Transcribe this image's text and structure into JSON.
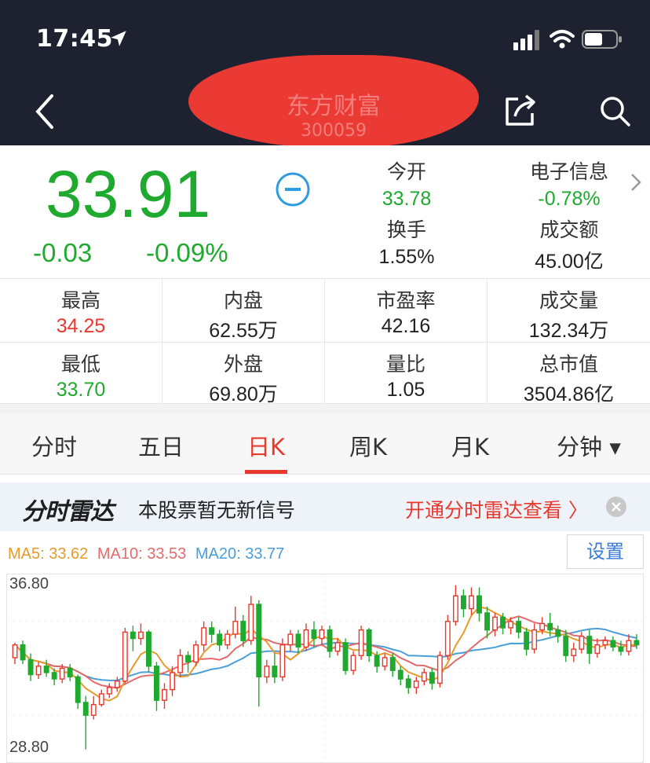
{
  "status_bar": {
    "time": "17:45"
  },
  "header": {
    "stock_name": "东方财富",
    "stock_code": "300059",
    "colors": {
      "background": "#1e2230",
      "redaction": "#ea3a33"
    }
  },
  "quote": {
    "price": "33.91",
    "change": "-0.03",
    "change_pct": "-0.09%",
    "open_label": "今开",
    "open_value": "33.78",
    "sector_label": "电子信息",
    "sector_change": "-0.78%",
    "turnover_label": "换手",
    "turnover_value": "1.55%",
    "amount_label": "成交额",
    "amount_value": "45.00亿",
    "colors": {
      "down": "#1faa2f",
      "up": "#e8392e"
    }
  },
  "stats": [
    {
      "label": "最高",
      "value": "34.25",
      "color": "#e8392e"
    },
    {
      "label": "内盘",
      "value": "62.55万",
      "color": "#222222"
    },
    {
      "label": "市盈率",
      "value": "42.16",
      "color": "#222222"
    },
    {
      "label": "成交量",
      "value": "132.34万",
      "color": "#222222"
    },
    {
      "label": "最低",
      "value": "33.70",
      "color": "#1faa2f"
    },
    {
      "label": "外盘",
      "value": "69.80万",
      "color": "#222222"
    },
    {
      "label": "量比",
      "value": "1.05",
      "color": "#222222"
    },
    {
      "label": "总市值",
      "value": "3504.86亿",
      "color": "#222222"
    }
  ],
  "tabs": [
    {
      "label": "分时"
    },
    {
      "label": "五日"
    },
    {
      "label": "日K",
      "active": true
    },
    {
      "label": "周K"
    },
    {
      "label": "月K"
    },
    {
      "label": "分钟 ▾"
    }
  ],
  "radar": {
    "logo": "分时雷达",
    "message": "本股票暂无新信号",
    "link": "开通分时雷达查看 〉"
  },
  "ma": {
    "ma5": "MA5: 33.62",
    "ma10": "MA10: 33.53",
    "ma20": "MA20: 33.77"
  },
  "settings_label": "设置",
  "chart_data": {
    "type": "candlestick",
    "y_axis_top": "36.80",
    "y_axis_bottom": "28.80",
    "ylim": [
      28.8,
      36.8
    ],
    "ma_colors": {
      "ma5": "#e89b2d",
      "ma10": "#e36b6b",
      "ma20": "#4a9fd8"
    },
    "candles": [
      [
        33.3,
        33.9,
        33.0,
        34.0
      ],
      [
        33.9,
        33.2,
        33.0,
        34.1
      ],
      [
        33.2,
        32.5,
        32.2,
        33.5
      ],
      [
        32.5,
        32.9,
        32.3,
        33.1
      ],
      [
        32.9,
        32.6,
        32.4,
        33.2
      ],
      [
        32.6,
        32.3,
        32.0,
        32.8
      ],
      [
        32.3,
        32.8,
        32.1,
        33.0
      ],
      [
        32.8,
        32.4,
        32.2,
        33.0
      ],
      [
        32.4,
        31.2,
        30.9,
        32.5
      ],
      [
        31.2,
        30.6,
        29.0,
        31.5
      ],
      [
        30.6,
        31.1,
        30.4,
        31.5
      ],
      [
        31.1,
        31.6,
        31.0,
        31.8
      ],
      [
        31.6,
        31.9,
        31.4,
        32.1
      ],
      [
        31.9,
        32.2,
        31.7,
        32.4
      ],
      [
        32.2,
        34.5,
        32.1,
        34.7
      ],
      [
        34.5,
        34.2,
        33.6,
        34.8
      ],
      [
        34.2,
        34.5,
        33.9,
        34.9
      ],
      [
        34.5,
        32.9,
        32.6,
        34.6
      ],
      [
        32.9,
        31.3,
        30.8,
        33.1
      ],
      [
        31.3,
        31.8,
        30.9,
        32.1
      ],
      [
        31.8,
        32.6,
        31.5,
        32.9
      ],
      [
        32.6,
        33.4,
        32.4,
        33.7
      ],
      [
        33.4,
        33.1,
        32.6,
        33.6
      ],
      [
        33.1,
        33.9,
        32.9,
        34.1
      ],
      [
        33.9,
        34.7,
        33.6,
        35.0
      ],
      [
        34.7,
        34.4,
        34.0,
        35.0
      ],
      [
        34.4,
        33.9,
        33.6,
        34.6
      ],
      [
        33.9,
        34.4,
        33.7,
        34.6
      ],
      [
        34.4,
        35.0,
        34.2,
        35.7
      ],
      [
        35.0,
        34.1,
        33.8,
        35.3
      ],
      [
        34.1,
        35.8,
        33.9,
        36.2
      ],
      [
        35.8,
        32.4,
        31.0,
        36.0
      ],
      [
        32.4,
        32.9,
        32.1,
        33.2
      ],
      [
        32.9,
        32.4,
        32.1,
        33.5
      ],
      [
        32.4,
        33.9,
        32.2,
        34.2
      ],
      [
        33.9,
        34.4,
        33.6,
        34.6
      ],
      [
        34.4,
        33.8,
        33.5,
        34.6
      ],
      [
        33.8,
        34.6,
        33.6,
        34.9
      ],
      [
        34.6,
        34.2,
        33.8,
        35.0
      ],
      [
        34.2,
        34.6,
        33.9,
        34.8
      ],
      [
        34.6,
        33.6,
        33.3,
        34.8
      ],
      [
        33.6,
        34.0,
        33.4,
        34.2
      ],
      [
        34.0,
        32.7,
        32.5,
        34.2
      ],
      [
        32.7,
        33.4,
        32.5,
        33.6
      ],
      [
        33.4,
        34.6,
        33.2,
        34.8
      ],
      [
        34.6,
        33.4,
        33.1,
        34.7
      ],
      [
        33.4,
        32.9,
        32.6,
        33.6
      ],
      [
        32.9,
        33.3,
        32.7,
        33.5
      ],
      [
        33.3,
        32.7,
        32.4,
        33.5
      ],
      [
        32.7,
        32.3,
        32.0,
        32.9
      ],
      [
        32.3,
        31.9,
        31.6,
        32.5
      ],
      [
        31.9,
        32.2,
        31.6,
        32.4
      ],
      [
        32.2,
        32.6,
        32.0,
        32.8
      ],
      [
        32.6,
        32.1,
        31.8,
        32.8
      ],
      [
        32.1,
        33.4,
        31.9,
        33.6
      ],
      [
        33.4,
        35.0,
        33.2,
        35.3
      ],
      [
        35.0,
        36.2,
        34.8,
        36.7
      ],
      [
        36.2,
        35.6,
        35.2,
        36.5
      ],
      [
        35.6,
        36.2,
        35.3,
        36.6
      ],
      [
        36.2,
        35.4,
        35.0,
        36.6
      ],
      [
        35.4,
        34.6,
        34.2,
        35.7
      ],
      [
        34.6,
        35.2,
        34.3,
        35.4
      ],
      [
        35.2,
        34.7,
        34.4,
        35.4
      ],
      [
        34.7,
        35.0,
        34.4,
        35.2
      ],
      [
        35.0,
        34.5,
        34.2,
        35.2
      ],
      [
        34.5,
        33.7,
        33.4,
        34.7
      ],
      [
        33.7,
        34.6,
        33.5,
        34.9
      ],
      [
        34.6,
        34.9,
        34.4,
        35.2
      ],
      [
        34.9,
        34.6,
        34.3,
        35.4
      ],
      [
        34.6,
        34.3,
        34.0,
        34.8
      ],
      [
        34.3,
        33.4,
        33.1,
        34.6
      ],
      [
        33.4,
        33.7,
        33.1,
        34.0
      ],
      [
        33.7,
        34.3,
        33.5,
        34.5
      ],
      [
        34.3,
        33.5,
        33.0,
        34.6
      ],
      [
        33.5,
        33.9,
        33.3,
        34.2
      ],
      [
        33.9,
        34.1,
        33.7,
        34.3
      ],
      [
        34.1,
        33.8,
        33.6,
        34.3
      ],
      [
        33.8,
        33.6,
        33.4,
        34.1
      ],
      [
        33.6,
        34.1,
        33.4,
        34.4
      ],
      [
        34.1,
        33.9,
        33.7,
        34.4
      ]
    ]
  }
}
